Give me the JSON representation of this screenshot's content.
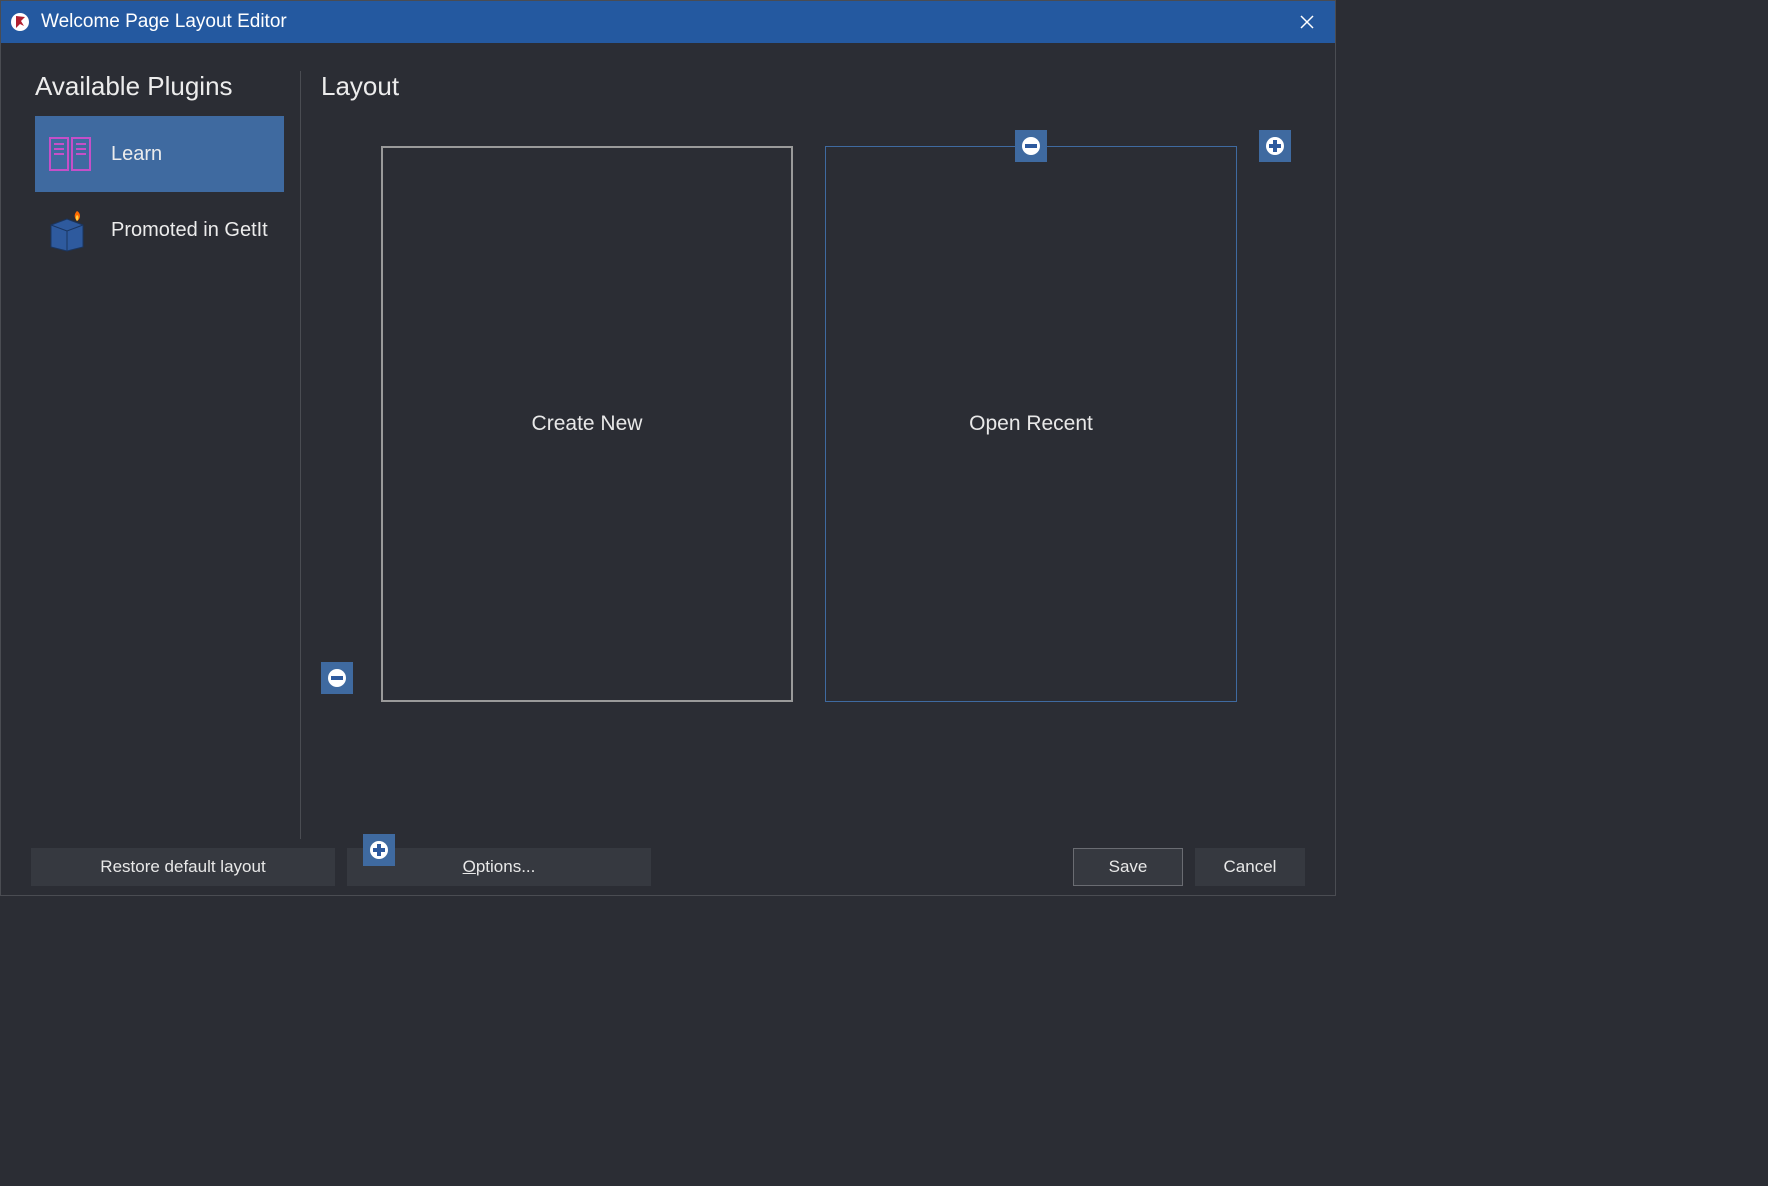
{
  "titlebar": {
    "title": "Welcome Page Layout Editor"
  },
  "left": {
    "heading": "Available Plugins",
    "items": [
      {
        "label": "Learn"
      },
      {
        "label": "Promoted in GetIt"
      }
    ]
  },
  "right": {
    "heading": "Layout",
    "tiles": [
      {
        "label": "Create New"
      },
      {
        "label": "Open Recent"
      }
    ]
  },
  "footer": {
    "restore": "Restore default layout",
    "options": "Options...",
    "save": "Save",
    "cancel": "Cancel"
  }
}
